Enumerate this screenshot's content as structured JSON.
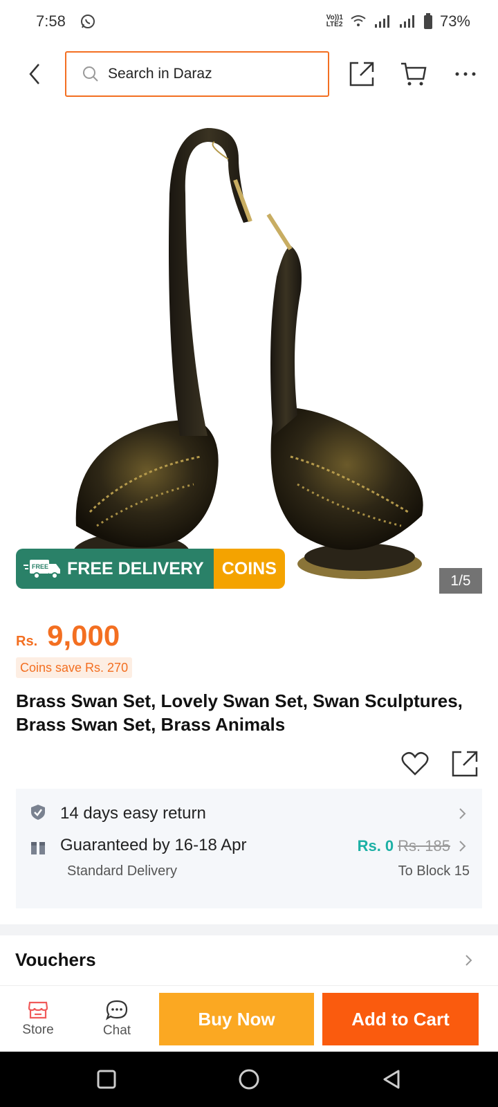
{
  "status_bar": {
    "time": "7:58",
    "whatsapp_icon": "whatsapp-icon",
    "network_label_top": "Vo))1",
    "network_label_bottom": "LTE2",
    "battery": "73%"
  },
  "header": {
    "search_placeholder": "Search in Daraz"
  },
  "gallery": {
    "promo_free_badge": "FREE",
    "promo_free_delivery": "FREE DELIVERY",
    "promo_coins": "COINS",
    "counter": "1/5"
  },
  "product": {
    "currency": "Rs.",
    "price": "9,000",
    "coins_save": "Coins save Rs. 270",
    "title": "Brass Swan Set, Lovely Swan Set, Swan Sculptures, Brass Swan Set, Brass Animals"
  },
  "services": {
    "return_text": "14 days easy return",
    "delivery_text": "Guaranteed by 16-18 Apr",
    "delivery_sub": "Standard Delivery",
    "fee": "Rs. 0",
    "fee_old": "Rs. 185",
    "destination": "To Block 15"
  },
  "vouchers": {
    "label": "Vouchers"
  },
  "bottom_bar": {
    "store": "Store",
    "chat": "Chat",
    "buy_now": "Buy Now",
    "add_to_cart": "Add to Cart"
  },
  "colors": {
    "accent": "#f36f21",
    "buy_now": "#fba822",
    "add_to_cart": "#fa5b0e",
    "free_delivery": "#2a8168",
    "coins": "#f4a300",
    "free_fee": "#1cb0a5"
  }
}
